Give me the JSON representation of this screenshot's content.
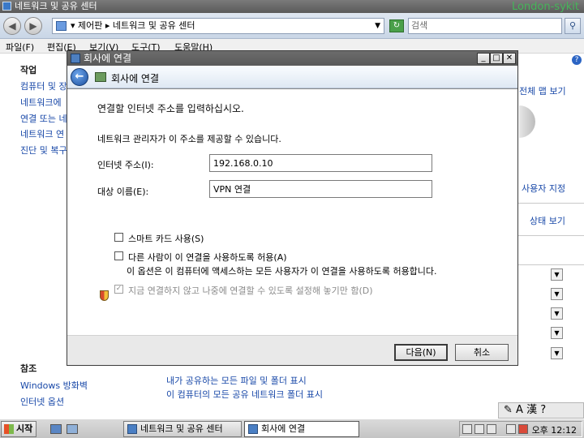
{
  "background_window": {
    "title": "네트워크 및 공유 센터",
    "watermark": "London-sykit",
    "breadcrumb": "▾ 제어판 ▸ 네트워크 및 공유 센터",
    "search_placeholder": "검색",
    "menu": [
      "파일(F)",
      "편집(E)",
      "보기(V)",
      "도구(T)",
      "도움말(H)"
    ],
    "tasks_heading": "작업",
    "tasks": [
      "컴퓨터 및 장",
      "네트워크에",
      "연결 또는 네",
      "네트워크 연",
      "진단 및 복구"
    ],
    "see_also_heading": "참조",
    "see_also": [
      "Windows 방화벽",
      "인터넷 옵션"
    ],
    "bottom_links": [
      "내가 공유하는 모든 파일 및 폴더 표시",
      "이 컴퓨터의 모든 공유 네트워크 폴더 표시"
    ],
    "right_links": [
      "전체 맵 보기",
      "사용자 지정",
      "상태 보기"
    ],
    "language_bar": "A 漢"
  },
  "taskbar": {
    "start_label": "시작",
    "tasks": [
      "네트워크 및 공유 센터",
      "회사에 연결"
    ],
    "clock": "오후 12:12"
  },
  "dialog": {
    "window_title": "회사에 연결",
    "header_title": "회사에 연결",
    "heading": "연결할 인터넷 주소를 입력하십시오.",
    "description": "네트워크 관리자가 이 주소를 제공할 수 있습니다.",
    "address_label": "인터넷 주소(I):",
    "address_value": "192.168.0.10",
    "destination_label": "대상 이름(E):",
    "destination_value": "VPN 연결",
    "smartcard_label": "스마트 카드 사용(S)",
    "allow_others_label": "다른 사람이 이 연결을 사용하도록 허용(A)",
    "allow_others_note": "이 옵션은 이 컴퓨터에 액세스하는 모든 사용자가 이 연결을 사용하도록 허용합니다.",
    "dont_connect_label": "지금 연결하지 않고 나중에 연결할 수 있도록 설정해 놓기만 함(D)",
    "next_button": "다음(N)",
    "cancel_button": "취소"
  }
}
